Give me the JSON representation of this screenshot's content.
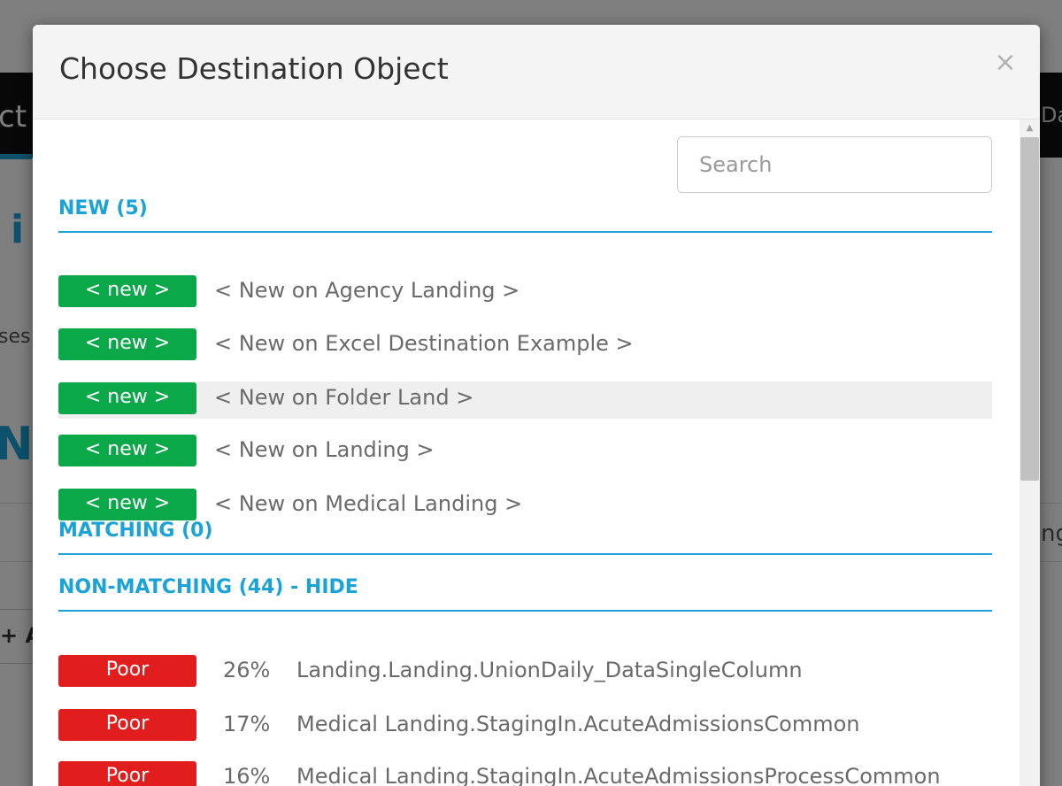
{
  "background": {
    "left_tab_fragment": "ct",
    "right_tab_fragment": "Da",
    "heading_fragment": "i",
    "snippet_fragment": "ses",
    "heading2_fragment": "N",
    "right_snippet_fragment": "ng",
    "add_link_fragment": "+ A"
  },
  "modal": {
    "title": "Choose Destination Object",
    "close_glyph": "×",
    "search_placeholder": "Search",
    "sections": {
      "new": {
        "title": "NEW (5)",
        "items": [
          {
            "badge": "< new >",
            "label": "< New on Agency Landing >"
          },
          {
            "badge": "< new >",
            "label": "< New on Excel Destination Example >"
          },
          {
            "badge": "< new >",
            "label": "< New on Folder Land >"
          },
          {
            "badge": "< new >",
            "label": "< New on Landing >"
          },
          {
            "badge": "< new >",
            "label": "< New on Medical Landing >"
          }
        ]
      },
      "matching": {
        "title": "MATCHING (0)"
      },
      "non_matching": {
        "title": "NON-MATCHING (44) - HIDE",
        "items": [
          {
            "badge": "Poor",
            "percent": "26%",
            "name": "Landing.Landing.UnionDaily_DataSingleColumn"
          },
          {
            "badge": "Poor",
            "percent": "17%",
            "name": "Medical Landing.StagingIn.AcuteAdmissionsCommon"
          },
          {
            "badge": "Poor",
            "percent": "16%",
            "name": "Medical Landing.StagingIn.AcuteAdmissionsProcessCommon"
          }
        ]
      }
    }
  },
  "colors": {
    "accent": "#1aa3d8",
    "new_badge": "#0ba84a",
    "poor_badge": "#e21d1d",
    "row_highlight": "#efefef"
  },
  "icons": {
    "close": "close-icon",
    "scroll_up": "chevron-up-icon"
  }
}
